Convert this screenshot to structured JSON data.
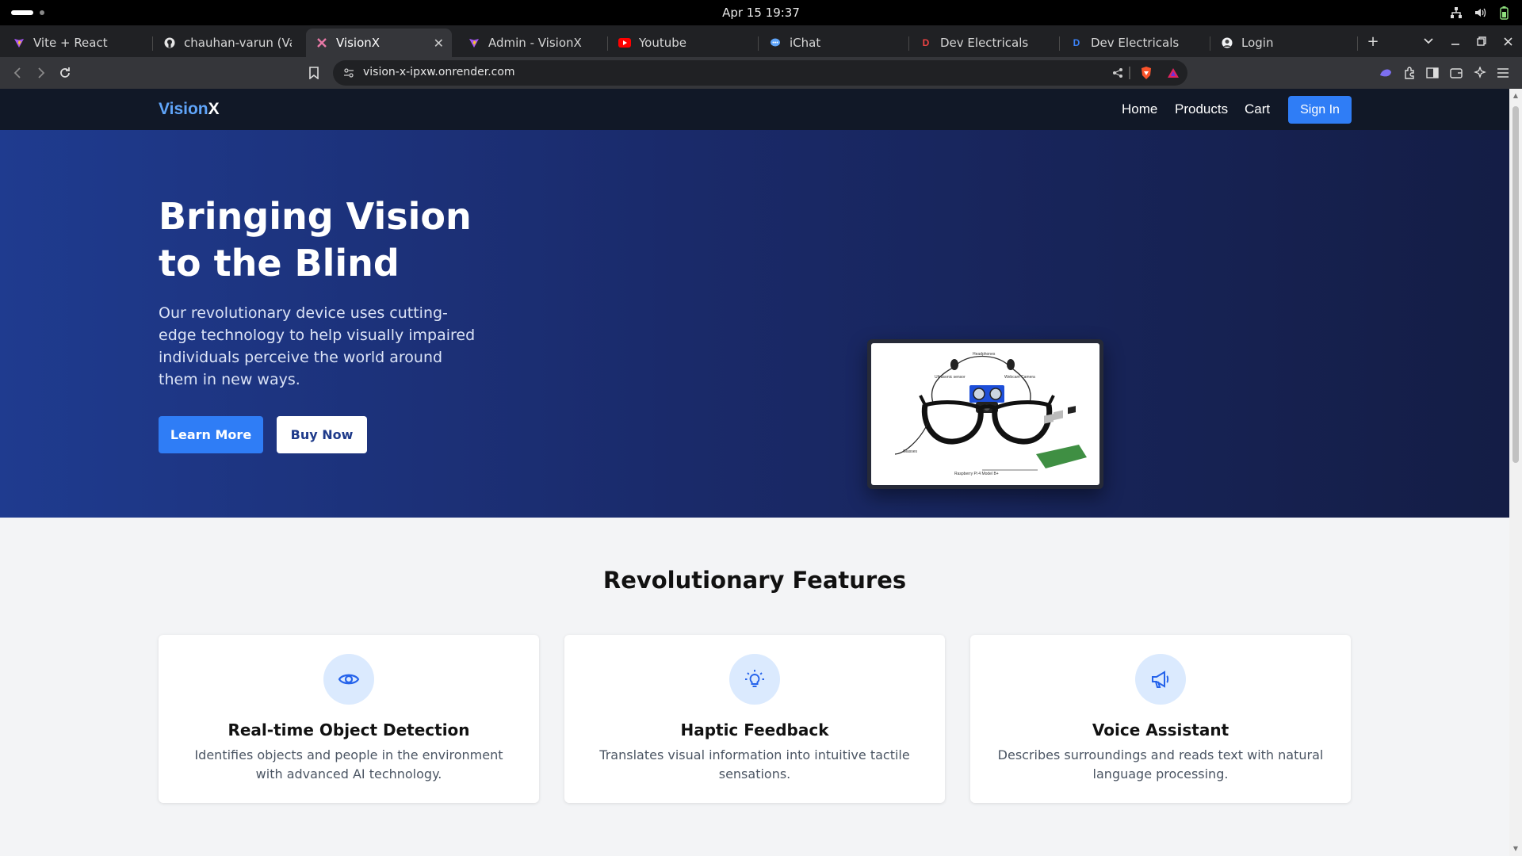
{
  "os": {
    "clock": "Apr 15  19:37"
  },
  "browser": {
    "tabs": [
      {
        "title": "Vite + React",
        "favicon": "vite-icon"
      },
      {
        "title": "chauhan-varun (Varun",
        "favicon": "github-icon"
      },
      {
        "title": "VisionX",
        "favicon": "visionx-icon",
        "active": true
      },
      {
        "title": "Admin - VisionX",
        "favicon": "vite-icon"
      },
      {
        "title": "Youtube",
        "favicon": "youtube-icon"
      },
      {
        "title": "iChat",
        "favicon": "chat-icon"
      },
      {
        "title": "Dev Electricals",
        "favicon": "dev-icon"
      },
      {
        "title": "Dev Electricals",
        "favicon": "dev-icon"
      },
      {
        "title": "Login",
        "favicon": "avatar-icon"
      }
    ],
    "new_tab": "+",
    "url": "vision-x-ipxw.onrender.com"
  },
  "site": {
    "logo_a": "Vision",
    "logo_b": "X",
    "nav": {
      "home": "Home",
      "products": "Products",
      "cart": "Cart",
      "signin": "Sign In"
    },
    "hero": {
      "title": "Bringing Vision to the Blind",
      "subtitle": "Our revolutionary device uses cutting-edge technology to help visually impaired individuals perceive the world around them in new ways.",
      "learn_more": "Learn More",
      "buy_now": "Buy Now",
      "image_labels": {
        "headphones": "Headphones",
        "ultrasonic": "Ultrasonic sensor",
        "webcam": "Webcam Camera",
        "glasses": "Glasses",
        "raspberry": "Raspberry Pi 4 Model B+"
      }
    },
    "features": {
      "title": "Revolutionary Features",
      "items": [
        {
          "title": "Real-time Object Detection",
          "desc": "Identifies objects and people in the environment with advanced AI technology.",
          "icon": "eye-icon"
        },
        {
          "title": "Haptic Feedback",
          "desc": "Translates visual information into intuitive tactile sensations.",
          "icon": "lightbulb-icon"
        },
        {
          "title": "Voice Assistant",
          "desc": "Describes surroundings and reads text with natural language processing.",
          "icon": "megaphone-icon"
        }
      ]
    }
  },
  "colors": {
    "accent": "#2f7df6",
    "nav_bg": "#111827",
    "hero_start": "#1f3b8f",
    "hero_end": "#141d45",
    "logo_accent": "#60a5fa"
  }
}
